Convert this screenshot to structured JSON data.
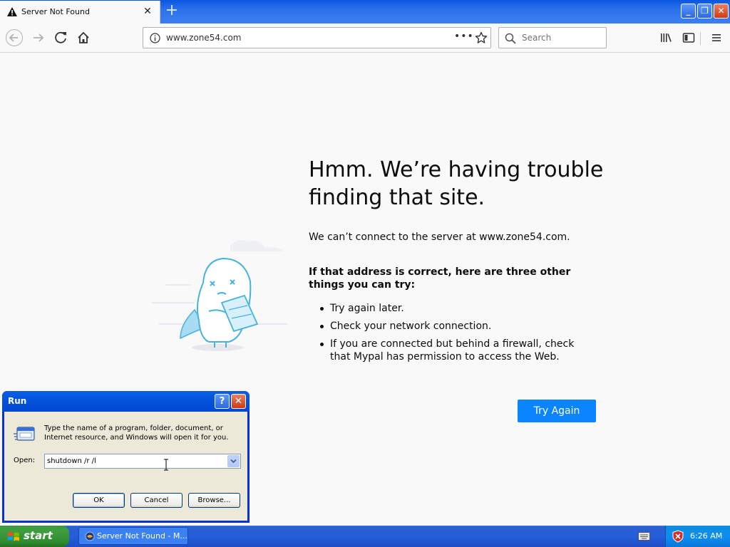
{
  "browser": {
    "tab": {
      "title": "Server Not Found",
      "close_glyph": "✕"
    },
    "new_tab_glyph": "+",
    "url": "www.zone54.com",
    "page_actions_glyph": "•••",
    "search_placeholder": "Search",
    "window_buttons": {
      "minimize": "_",
      "maximize": "❐",
      "close": "✕"
    }
  },
  "error_page": {
    "title": "Hmm. We’re having trouble finding that site.",
    "description": "We can’t connect to the server at www.zone54.com.",
    "hint": "If that address is correct, here are three other things you can try:",
    "items": [
      "Try again later.",
      "Check your network connection.",
      "If you are connected but behind a firewall, check that Mypal has permission to access the Web."
    ],
    "try_again_label": "Try Again"
  },
  "run_dialog": {
    "title": "Run",
    "help_glyph": "?",
    "close_glyph": "✕",
    "description": "Type the name of a program, folder, document, or Internet resource, and Windows will open it for you.",
    "open_label": "Open:",
    "open_value": "shutdown /r /l",
    "ok_label": "OK",
    "cancel_label": "Cancel",
    "browse_label": "Browse..."
  },
  "taskbar": {
    "start_label": "start",
    "task_label": "Server Not Found - M...",
    "clock": "6:26 AM"
  },
  "colors": {
    "accent_blue": "#0a84ff",
    "xp_taskbar": "#245edb",
    "xp_start_green": "#3f9f40",
    "page_bg": "#f9f9fa"
  }
}
